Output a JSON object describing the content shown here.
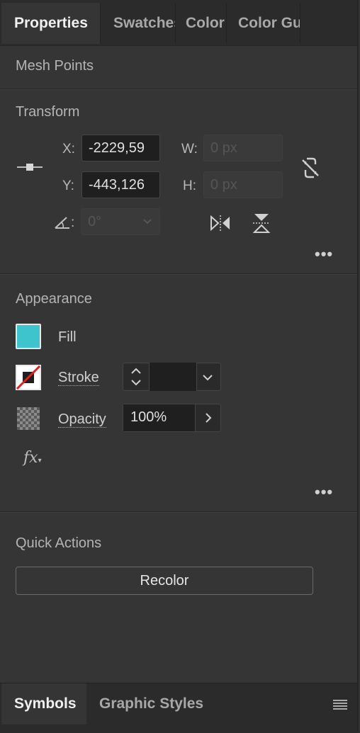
{
  "tabs": [
    {
      "label": "Properties",
      "active": true
    },
    {
      "label": "Swatches",
      "active": false
    },
    {
      "label": "Color",
      "active": false
    },
    {
      "label": "Color Gu",
      "active": false
    }
  ],
  "mesh_points": "Mesh Points",
  "transform": {
    "title": "Transform",
    "x_label": "X:",
    "x_value": "-2229,59",
    "y_label": "Y:",
    "y_value": "-443,126",
    "w_label": "W:",
    "w_value": "0 px",
    "h_label": "H:",
    "h_value": "0 px",
    "angle_label": ":",
    "angle_value": "0°"
  },
  "appearance": {
    "title": "Appearance",
    "fill_label": "Fill",
    "fill_color": "#3ec4cc",
    "stroke_label": "Stroke",
    "opacity_label": "Opacity",
    "opacity_value": "100%",
    "fx_label": "fx"
  },
  "quick_actions": {
    "title": "Quick Actions",
    "recolor_label": "Recolor"
  },
  "bottom_tabs": [
    {
      "label": "Symbols",
      "active": true
    },
    {
      "label": "Graphic Styles",
      "active": false
    }
  ],
  "icons": {
    "more": "more-options-icon",
    "constrain": "constrain-link-icon",
    "flip_h": "flip-horizontal-icon",
    "flip_v": "flip-vertical-icon",
    "panel_menu": "panel-menu-icon"
  }
}
